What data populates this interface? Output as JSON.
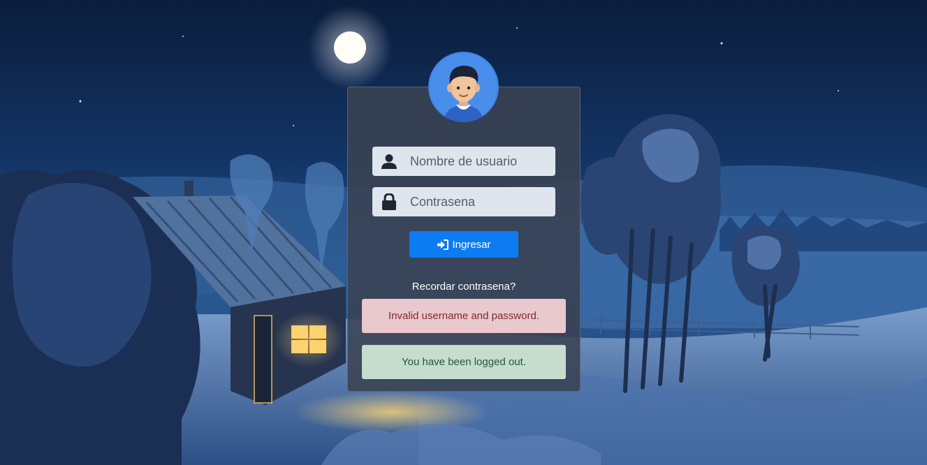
{
  "login": {
    "username_placeholder": "Nombre de usuario",
    "password_placeholder": "Contrasena",
    "submit_label": "Ingresar",
    "remember_link": "Recordar contrasena?"
  },
  "alerts": {
    "error": "Invalid username and password.",
    "logout": "You have been logged out."
  },
  "icons": {
    "avatar": "user-avatar-icon",
    "username": "user-icon",
    "password": "lock-icon",
    "submit": "sign-in-icon"
  },
  "colors": {
    "primary_button": "#0d7bf2",
    "error_alert_bg": "#f4d1d5",
    "success_alert_bg": "#cfe7d6",
    "avatar_bg": "#4285e6"
  }
}
